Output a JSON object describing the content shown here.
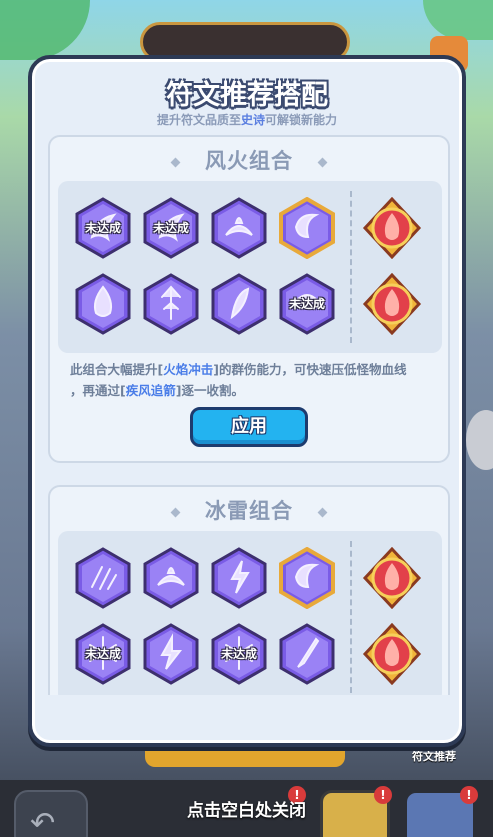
{
  "dialog": {
    "title": "符文推荐搭配",
    "subtitle_prefix": "提升符文品质至",
    "subtitle_highlight": "史诗",
    "subtitle_suffix": "可解锁新能力"
  },
  "combos": [
    {
      "name": "风火组合",
      "runes_row1": [
        {
          "icon": "wind-rune-icon",
          "status": "未达成",
          "gold": false
        },
        {
          "icon": "wind-rune-icon",
          "status": "未达成",
          "gold": false
        },
        {
          "icon": "splash-rune-icon",
          "status": "",
          "gold": false
        },
        {
          "icon": "crescent-rune-icon",
          "status": "",
          "gold": true
        }
      ],
      "runes_row2": [
        {
          "icon": "flame-rune-icon",
          "status": "",
          "gold": false
        },
        {
          "icon": "arrow-rune-icon",
          "status": "",
          "gold": false
        },
        {
          "icon": "feather-rune-icon",
          "status": "",
          "gold": false
        },
        {
          "icon": "storm-rune-icon",
          "status": "未达成",
          "gold": false
        }
      ],
      "skills": [
        "fire-impact-skill-icon",
        "wind-vortex-skill-icon"
      ],
      "desc_line1_a": "此组合大幅提升[",
      "desc_kw1": "火焰冲击",
      "desc_line1_b": "]的群伤能力，可快速压低怪物血线",
      "desc_line2_a": "，再通过[",
      "desc_kw2": "疾风追箭",
      "desc_line2_b": "]逐一收割。",
      "apply_label": "应用"
    },
    {
      "name": "冰雷组合",
      "runes_row1": [
        {
          "icon": "claw-rune-icon",
          "status": "",
          "gold": false
        },
        {
          "icon": "splash-rune-icon",
          "status": "",
          "gold": false
        },
        {
          "icon": "lightning-rune-icon",
          "status": "",
          "gold": false
        },
        {
          "icon": "crescent-rune-icon",
          "status": "",
          "gold": true
        }
      ],
      "runes_row2": [
        {
          "icon": "frost-rune-icon",
          "status": "未达成",
          "gold": false
        },
        {
          "icon": "thunder-rune-icon",
          "status": "",
          "gold": false
        },
        {
          "icon": "frost-rune-icon",
          "status": "未达成",
          "gold": false
        },
        {
          "icon": "blade-rune-icon",
          "status": "",
          "gold": false
        }
      ],
      "skills": [
        "ice-crystal-skill-icon",
        "fire-burst-skill-icon"
      ]
    }
  ],
  "background": {
    "close_hint": "点击空白处关闭",
    "side_label": "符文推荐",
    "badge": "!"
  },
  "colors": {
    "accent": "#23b3f0",
    "rune_purple": "#8c6cf0",
    "skill_red": "#e2404a",
    "keyword_blue": "#4a7de8"
  }
}
